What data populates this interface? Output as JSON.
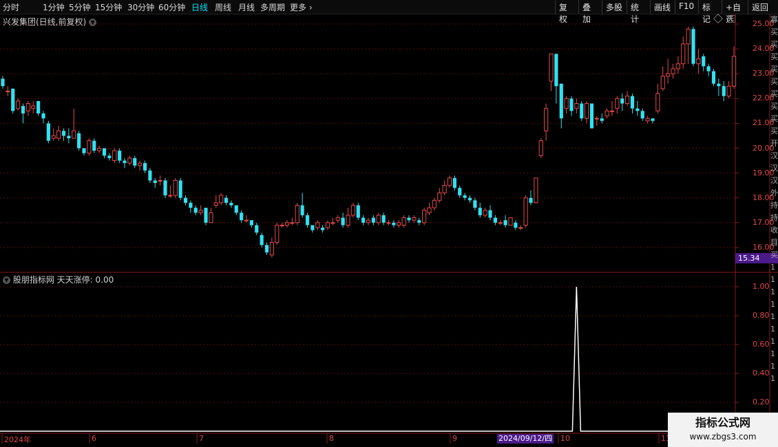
{
  "toolbar": {
    "periods": [
      "分时",
      "1分钟",
      "5分钟",
      "15分钟",
      "30分钟",
      "60分钟",
      "日线",
      "周线",
      "月线",
      "多周期",
      "更多"
    ],
    "active": "日线",
    "right_buttons": [
      "复权",
      "叠加",
      "多股",
      "统计",
      "画线",
      "F10",
      "标记",
      "+自选",
      "返回"
    ]
  },
  "stock": {
    "title": "兴发集团(日线,前复权)"
  },
  "indicator": {
    "title": "股朋指标网 天天涨停: 0.00"
  },
  "price_axis": [
    "25.00",
    "24.00",
    "23.00",
    "22.00",
    "21.00",
    "20.00",
    "19.00",
    "18.00",
    "17.00",
    "16.00"
  ],
  "current_price": "15.34",
  "ind_axis": [
    "1.00",
    "0.80",
    "0.60",
    "0.40",
    "0.20"
  ],
  "dates": [
    "2024年",
    "6",
    "7",
    "8",
    "9",
    "10",
    "11"
  ],
  "crosshair_date": "2024/09/12/四",
  "right_strip": [
    "寡",
    "买",
    "买",
    "买",
    "买",
    "买",
    "买",
    "买",
    "买",
    "买",
    "开",
    "汉",
    "汉",
    "汉",
    "外",
    "持",
    "持",
    "收",
    "目",
    "买",
    "1",
    "1",
    "1",
    "1",
    "1",
    "1",
    "1",
    "1",
    "1",
    "1"
  ],
  "watermark": {
    "line1": "指标公式网",
    "line2": "www.zbgs3.com"
  },
  "colors": {
    "up": "#e84a4a",
    "down": "#33e0f0",
    "grid": "#5a0e0e"
  },
  "chart_data": {
    "type": "candlestick",
    "ylim": [
      15.5,
      25.2
    ],
    "candles": [
      [
        22.8,
        22.5,
        22.9,
        22.4
      ],
      [
        22.3,
        22.3,
        22.5,
        22.1
      ],
      [
        22.4,
        21.5,
        22.4,
        21.4
      ],
      [
        21.6,
        21.9,
        22.0,
        21.5
      ],
      [
        21.7,
        21.4,
        21.8,
        21.0
      ],
      [
        21.5,
        21.8,
        21.9,
        21.3
      ],
      [
        21.6,
        21.7,
        21.9,
        21.4
      ],
      [
        21.9,
        21.4,
        21.9,
        21.3
      ],
      [
        21.4,
        21.2,
        21.5,
        21.0
      ],
      [
        21.0,
        20.3,
        21.1,
        20.2
      ],
      [
        20.4,
        20.5,
        20.8,
        20.3
      ],
      [
        20.4,
        20.7,
        20.9,
        20.3
      ],
      [
        20.7,
        20.5,
        20.8,
        20.3
      ],
      [
        20.5,
        20.4,
        20.8,
        20.2
      ],
      [
        20.4,
        20.7,
        21.6,
        20.4
      ],
      [
        20.6,
        20.0,
        20.7,
        19.9
      ],
      [
        20.0,
        19.8,
        20.0,
        19.7
      ],
      [
        19.8,
        20.3,
        20.4,
        19.7
      ],
      [
        20.3,
        19.9,
        20.4,
        19.8
      ],
      [
        19.9,
        20.0,
        20.1,
        19.8
      ],
      [
        20.0,
        19.7,
        20.0,
        19.6
      ],
      [
        19.7,
        19.6,
        19.8,
        19.5
      ],
      [
        19.5,
        19.9,
        20.0,
        19.4
      ],
      [
        19.9,
        19.5,
        20.0,
        19.4
      ],
      [
        19.5,
        19.4,
        19.6,
        19.2
      ],
      [
        19.4,
        19.6,
        19.7,
        19.3
      ],
      [
        19.6,
        19.3,
        19.7,
        19.2
      ],
      [
        19.3,
        19.4,
        19.5,
        19.1
      ],
      [
        19.4,
        19.1,
        19.5,
        19.0
      ],
      [
        19.1,
        18.7,
        19.2,
        18.6
      ],
      [
        18.7,
        18.6,
        18.8,
        18.4
      ],
      [
        18.7,
        18.7,
        18.9,
        18.5
      ],
      [
        18.7,
        18.1,
        18.8,
        18.0
      ],
      [
        18.1,
        18.1,
        18.5,
        18.0
      ],
      [
        18.1,
        18.7,
        18.8,
        18.0
      ],
      [
        18.7,
        18.0,
        18.8,
        17.9
      ],
      [
        18.0,
        17.8,
        18.1,
        17.7
      ],
      [
        17.8,
        17.6,
        17.9,
        17.4
      ],
      [
        17.6,
        17.4,
        17.7,
        17.3
      ],
      [
        17.4,
        17.5,
        17.7,
        17.3
      ],
      [
        17.6,
        17.0,
        17.6,
        16.9
      ],
      [
        17.0,
        17.4,
        17.6,
        17.0
      ],
      [
        17.7,
        17.8,
        18.1,
        17.6
      ],
      [
        17.8,
        18.1,
        18.2,
        17.7
      ],
      [
        18.0,
        17.8,
        18.1,
        17.7
      ],
      [
        17.8,
        17.7,
        17.9,
        17.6
      ],
      [
        17.7,
        17.4,
        17.7,
        17.3
      ],
      [
        17.4,
        17.1,
        17.5,
        17.0
      ],
      [
        17.1,
        17.1,
        17.3,
        17.0
      ],
      [
        17.1,
        16.9,
        17.1,
        16.8
      ],
      [
        16.9,
        16.6,
        17.0,
        16.5
      ],
      [
        16.5,
        16.1,
        16.6,
        16.0
      ],
      [
        16.1,
        15.8,
        16.2,
        15.7
      ],
      [
        15.7,
        16.2,
        16.4,
        15.6
      ],
      [
        16.2,
        16.9,
        17.0,
        16.1
      ],
      [
        16.9,
        16.9,
        17.0,
        16.8
      ],
      [
        16.9,
        17.0,
        17.1,
        16.8
      ],
      [
        17.0,
        17.0,
        17.2,
        16.9
      ],
      [
        17.0,
        17.7,
        17.8,
        16.9
      ],
      [
        17.7,
        17.3,
        18.2,
        17.2
      ],
      [
        17.3,
        16.9,
        17.4,
        16.8
      ],
      [
        16.9,
        16.7,
        16.9,
        16.6
      ],
      [
        16.8,
        17.0,
        17.1,
        16.7
      ],
      [
        16.8,
        16.7,
        16.9,
        16.6
      ],
      [
        16.8,
        17.0,
        17.1,
        16.7
      ],
      [
        17.0,
        17.0,
        17.2,
        16.9
      ],
      [
        17.1,
        17.2,
        17.3,
        17.0
      ],
      [
        17.2,
        16.9,
        17.4,
        16.8
      ],
      [
        16.9,
        17.3,
        17.6,
        16.8
      ],
      [
        17.3,
        17.7,
        17.8,
        17.2
      ],
      [
        17.7,
        17.2,
        17.8,
        17.1
      ],
      [
        17.2,
        17.0,
        17.3,
        16.9
      ],
      [
        17.0,
        17.1,
        17.2,
        16.9
      ],
      [
        17.2,
        17.0,
        17.3,
        16.9
      ],
      [
        17.0,
        17.3,
        17.4,
        16.9
      ],
      [
        17.3,
        17.0,
        17.4,
        16.9
      ],
      [
        17.0,
        17.0,
        17.1,
        16.9
      ],
      [
        17.0,
        16.9,
        17.1,
        16.8
      ],
      [
        16.9,
        17.0,
        17.1,
        16.8
      ],
      [
        16.9,
        17.2,
        17.3,
        16.8
      ],
      [
        17.2,
        17.1,
        17.3,
        17.0
      ],
      [
        17.1,
        17.2,
        17.3,
        17.0
      ],
      [
        17.1,
        17.0,
        17.2,
        16.9
      ],
      [
        17.0,
        17.5,
        17.6,
        16.9
      ],
      [
        17.4,
        17.6,
        17.8,
        17.3
      ],
      [
        17.6,
        17.9,
        18.0,
        17.5
      ],
      [
        17.9,
        18.2,
        18.4,
        17.8
      ],
      [
        18.2,
        18.5,
        18.7,
        18.1
      ],
      [
        18.5,
        18.8,
        18.9,
        18.4
      ],
      [
        18.8,
        18.4,
        18.9,
        18.3
      ],
      [
        18.4,
        18.1,
        18.5,
        18.0
      ],
      [
        18.1,
        18.0,
        18.2,
        17.9
      ],
      [
        18.0,
        17.9,
        18.1,
        17.8
      ],
      [
        17.9,
        17.6,
        18.0,
        17.5
      ],
      [
        17.6,
        17.3,
        17.8,
        17.2
      ],
      [
        17.3,
        17.5,
        17.6,
        17.2
      ],
      [
        17.5,
        17.2,
        17.7,
        17.1
      ],
      [
        17.2,
        17.0,
        17.3,
        16.9
      ],
      [
        17.0,
        17.0,
        17.1,
        16.9
      ],
      [
        17.1,
        16.9,
        17.3,
        16.8
      ],
      [
        16.9,
        17.2,
        17.2,
        16.9
      ],
      [
        17.0,
        16.8,
        17.1,
        16.7
      ],
      [
        16.8,
        16.8,
        16.9,
        16.7
      ],
      [
        16.9,
        18.0,
        18.1,
        16.8
      ],
      [
        18.0,
        17.8,
        18.3,
        17.7
      ],
      [
        17.8,
        18.8,
        18.8,
        17.8
      ],
      [
        19.7,
        20.3,
        20.4,
        19.6
      ],
      [
        20.7,
        21.6,
        21.8,
        20.3
      ],
      [
        22.7,
        23.8,
        23.8,
        22.3
      ],
      [
        23.8,
        22.5,
        23.8,
        21.8
      ],
      [
        22.6,
        21.2,
        22.6,
        20.8
      ],
      [
        21.6,
        22.0,
        22.1,
        21.4
      ],
      [
        22.0,
        21.5,
        22.1,
        21.3
      ],
      [
        21.6,
        21.8,
        22.0,
        21.4
      ],
      [
        21.8,
        21.2,
        21.9,
        21.1
      ],
      [
        21.2,
        21.8,
        21.9,
        21.0
      ],
      [
        21.8,
        20.8,
        21.8,
        20.8
      ],
      [
        21.2,
        21.2,
        21.3,
        20.9
      ],
      [
        21.2,
        21.1,
        21.4,
        21.0
      ],
      [
        21.3,
        21.5,
        21.6,
        21.2
      ],
      [
        21.5,
        21.5,
        21.9,
        21.3
      ],
      [
        21.6,
        22.0,
        22.1,
        21.4
      ],
      [
        22.0,
        21.8,
        22.2,
        21.5
      ],
      [
        21.8,
        22.1,
        22.3,
        21.7
      ],
      [
        22.1,
        21.6,
        22.2,
        21.4
      ],
      [
        21.6,
        21.5,
        21.9,
        21.3
      ],
      [
        21.5,
        21.2,
        21.6,
        21.1
      ],
      [
        21.1,
        21.2,
        21.3,
        21.0
      ],
      [
        21.2,
        21.1,
        21.2,
        21.0
      ],
      [
        21.5,
        22.2,
        22.6,
        21.4
      ],
      [
        22.4,
        22.9,
        23.3,
        22.3
      ],
      [
        22.9,
        23.0,
        23.6,
        22.6
      ],
      [
        23.0,
        23.2,
        23.4,
        22.8
      ],
      [
        23.2,
        23.4,
        23.7,
        23.0
      ],
      [
        23.4,
        24.2,
        24.5,
        23.2
      ],
      [
        24.2,
        24.8,
        24.9,
        23.4
      ],
      [
        24.8,
        23.4,
        24.9,
        23.3
      ],
      [
        23.4,
        23.6,
        24.0,
        23.0
      ],
      [
        23.7,
        23.3,
        23.8,
        23.1
      ],
      [
        23.3,
        23.1,
        23.4,
        22.9
      ],
      [
        23.1,
        22.6,
        23.2,
        22.5
      ],
      [
        22.6,
        22.5,
        22.8,
        22.1
      ],
      [
        22.5,
        22.1,
        22.7,
        21.9
      ],
      [
        22.1,
        22.5,
        22.7,
        22.0
      ],
      [
        22.5,
        23.7,
        24.1,
        22.4
      ]
    ],
    "indicator_spike": {
      "index": 113,
      "value": 1.0
    },
    "ind_ylim": [
      0,
      1.0
    ]
  }
}
